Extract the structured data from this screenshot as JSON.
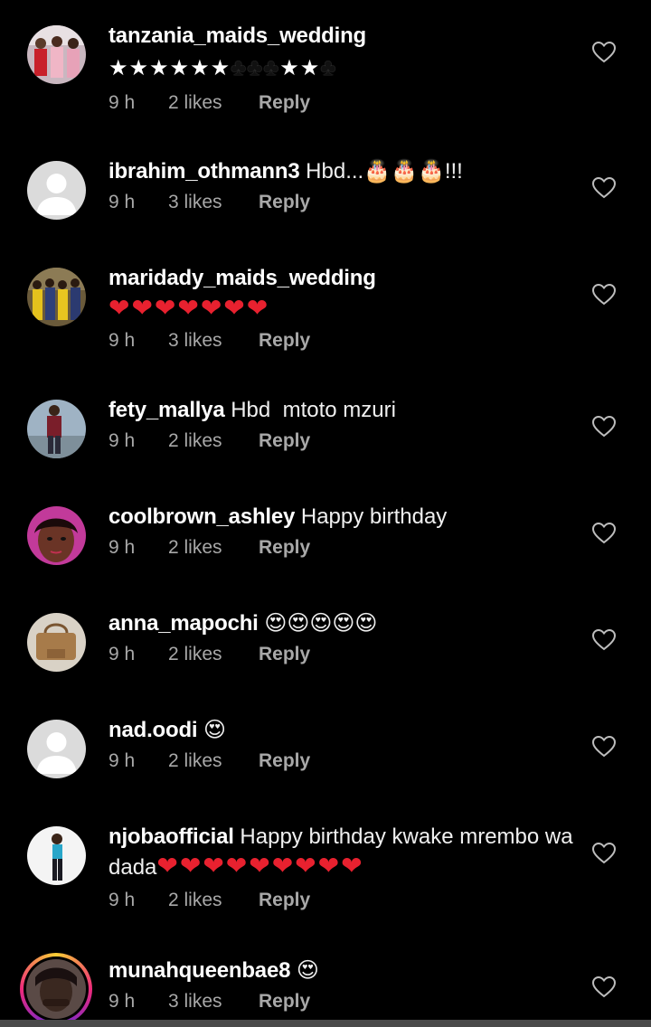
{
  "comments": [
    {
      "username": "tanzania_maids_wedding",
      "text": "",
      "emoji_line": "★★★★★★♣♣♣★★♣",
      "time": "9 h",
      "likes": "2 likes",
      "reply": "Reply"
    },
    {
      "username": "ibrahim_othmann3",
      "text": " Hbd...🎂🎂🎂!!!",
      "time": "9 h",
      "likes": "3 likes",
      "reply": "Reply"
    },
    {
      "username": "maridady_maids_wedding",
      "text": "",
      "emoji_line": "❤❤❤❤❤❤❤",
      "time": "9 h",
      "likes": "3 likes",
      "reply": "Reply"
    },
    {
      "username": "fety_mallya",
      "text": " Hbd  mtoto mzuri",
      "time": "9 h",
      "likes": "2 likes",
      "reply": "Reply"
    },
    {
      "username": "coolbrown_ashley",
      "text": " Happy birthday",
      "time": "9 h",
      "likes": "2 likes",
      "reply": "Reply"
    },
    {
      "username": "anna_mapochi",
      "text": " 😍😍😍😍😍",
      "time": "9 h",
      "likes": "2 likes",
      "reply": "Reply"
    },
    {
      "username": "nad.oodi",
      "text": " 😍",
      "time": "9 h",
      "likes": "2 likes",
      "reply": "Reply"
    },
    {
      "username": "njobaofficial",
      "text": " Happy birthday kwake mrembo wa dada",
      "hearts": "❤❤❤❤❤❤❤❤❤",
      "time": "9 h",
      "likes": "2 likes",
      "reply": "Reply"
    },
    {
      "username": "munahqueenbae8",
      "text": " 😍",
      "time": "9 h",
      "likes": "3 likes",
      "reply": "Reply"
    }
  ],
  "colors": {
    "background": "#000000",
    "username": "#ffffff",
    "meta": "#a8a8a8",
    "heart_emoji": "#e8212f"
  },
  "icons": {
    "like": "heart-outline-icon",
    "default_avatar": "default-avatar-icon"
  }
}
